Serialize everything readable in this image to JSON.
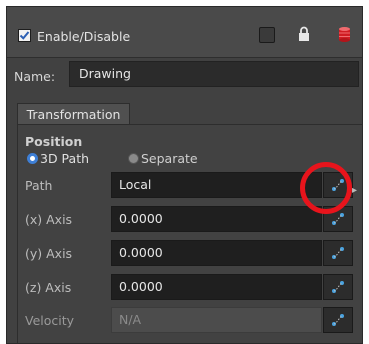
{
  "header": {
    "enable_label": "Enable/Disable",
    "enabled": true
  },
  "name": {
    "label": "Name:",
    "value": "Drawing"
  },
  "tabs": [
    {
      "label": "Transformation",
      "active": true
    }
  ],
  "position": {
    "heading": "Position",
    "modes": [
      {
        "label": "3D Path",
        "selected": true
      },
      {
        "label": "Separate",
        "selected": false
      }
    ]
  },
  "rows": [
    {
      "label": "Path",
      "value": "Local",
      "disabled": false
    },
    {
      "label": "(x) Axis",
      "value": "0.0000",
      "disabled": false
    },
    {
      "label": "(y) Axis",
      "value": "0.0000",
      "disabled": false
    },
    {
      "label": "(z) Axis",
      "value": "0.0000",
      "disabled": false
    },
    {
      "label": "Velocity",
      "value": "N/A",
      "disabled": true
    }
  ],
  "colors": {
    "panel_bg": "#414141",
    "field_bg": "#1f1f1f",
    "radio_accent": "#3e7fd6",
    "highlight": "#e8141c",
    "function_icon": "#4aa3e0"
  },
  "icons": [
    "check-icon",
    "square-toggle-icon",
    "lock-icon",
    "database-icon",
    "function-curve-icon",
    "arrow-right-icon"
  ]
}
